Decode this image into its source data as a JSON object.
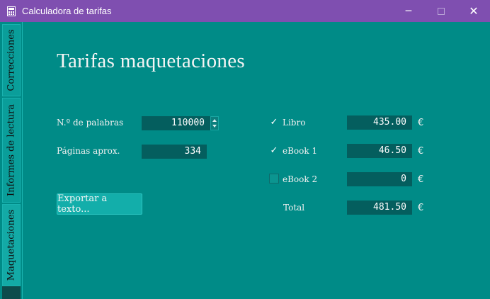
{
  "window": {
    "title": "Calculadora de tarifas",
    "minimize_glyph": "─",
    "maximize_glyph": "☐",
    "close_glyph": "✕",
    "icon": "calculator-icon"
  },
  "sidebar": {
    "tabs": [
      {
        "label": "Correcciones",
        "active": false
      },
      {
        "label": "Informes de lectura",
        "active": false
      },
      {
        "label": "Maquetaciones",
        "active": true
      }
    ]
  },
  "main": {
    "heading": "Tarifas maquetaciones",
    "words_label": "N.º de palabras",
    "words_value": "110000",
    "pages_label": "Páginas aprox.",
    "pages_value": "334",
    "export_button": "Exportar a texto...",
    "items": [
      {
        "label": "Libro",
        "checked": true,
        "value": "435.00",
        "currency": "€"
      },
      {
        "label": "eBook 1",
        "checked": true,
        "value": "46.50",
        "currency": "€"
      },
      {
        "label": "eBook 2",
        "checked": false,
        "value": "0",
        "currency": "€"
      }
    ],
    "total_label": "Total",
    "total_value": "481.50",
    "total_currency": "€",
    "check_glyph": "✓"
  },
  "colors": {
    "titlebar": "#7f4fb0",
    "background": "#008b87",
    "field": "#045e5e",
    "button": "#13aeaa"
  }
}
